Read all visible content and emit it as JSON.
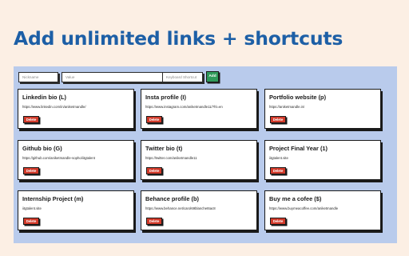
{
  "headline": "Add unlimited links + shortcuts",
  "form": {
    "nickname_placeholder": "Nickname",
    "value_placeholder": "Value",
    "shortcut_placeholder": "Keyboard Shortcut",
    "add_label": "Add"
  },
  "cards": [
    {
      "title": "Linkedin bio (L)",
      "url": "https://www.linkedin.com/in/aniketmandle/",
      "delete_label": "Delete"
    },
    {
      "title": "Insta profile (I)",
      "url": "https://www.instagram.com/aniketmandle11/?hl=en",
      "delete_label": "Delete"
    },
    {
      "title": "Portfolio website (p)",
      "url": "https://aniketmandle.in/",
      "delete_label": "Delete"
    },
    {
      "title": "Github bio (G)",
      "url": "https://github.com/aniketmandle-sopho/iitgtalent",
      "delete_label": "Delete"
    },
    {
      "title": "Twitter bio (t)",
      "url": "https://twitter.com/aniketmandle11",
      "delete_label": "Delete"
    },
    {
      "title": "Project Final Year (1)",
      "url": "iitgtalent.site",
      "delete_label": "Delete"
    },
    {
      "title": "Internship Project (m)",
      "url": "iitgtalent.site",
      "delete_label": "Delete"
    },
    {
      "title": "Behance profile (b)",
      "url": "https://www.behance.net/carol69blanchet6ac8",
      "delete_label": "Delete"
    },
    {
      "title": "Buy me a cofee ($)",
      "url": "https://www.buymeacoffee.com/aniketmandle",
      "delete_label": "Delete"
    }
  ],
  "colors": {
    "background": "#fcefe4",
    "headline": "#1d5fa6",
    "panel": "#b9cbec",
    "add_button": "#2f9a5a",
    "delete_button": "#d23a2a"
  }
}
